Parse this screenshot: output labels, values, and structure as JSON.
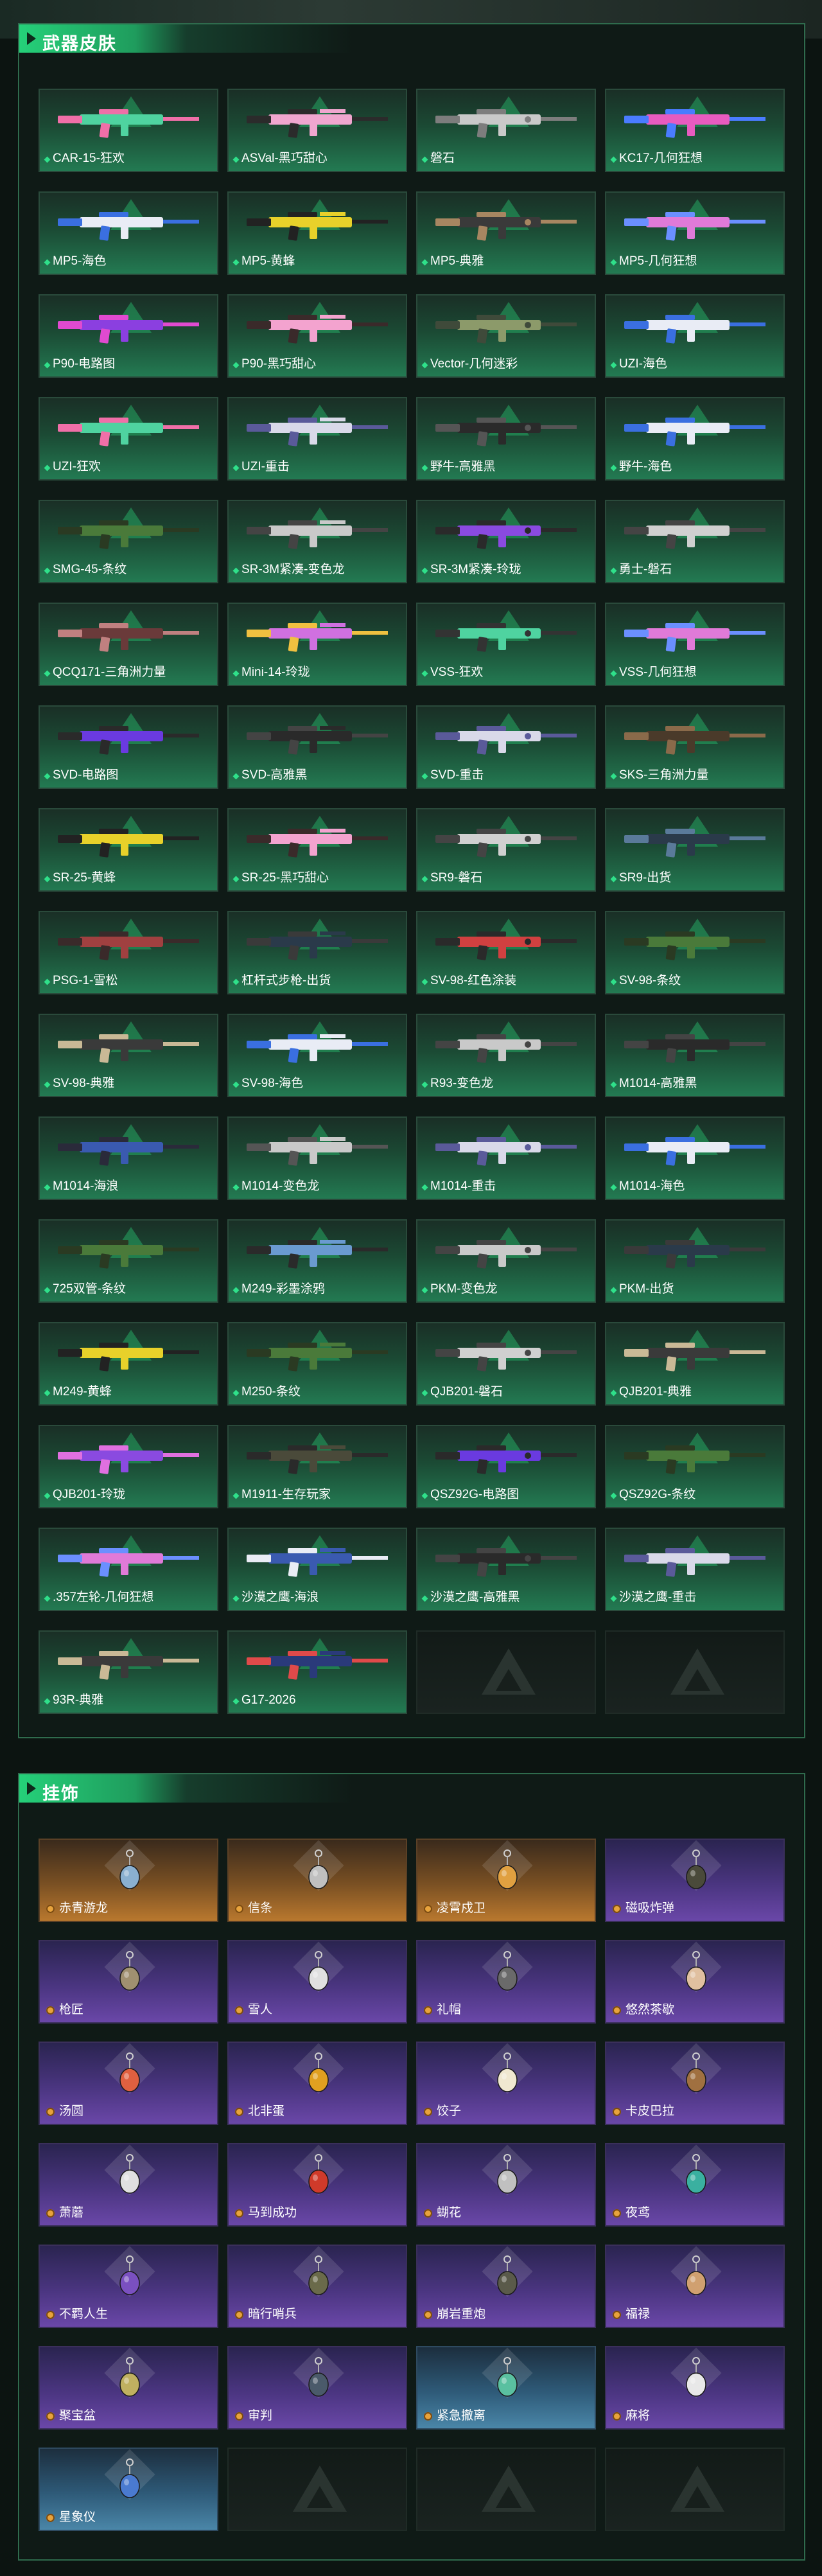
{
  "weapon_section": {
    "title": "武器皮肤",
    "items": [
      {
        "label": "CAR-15-狂欢",
        "color": "#4fd3a0",
        "accent": "#f06fa8"
      },
      {
        "label": "ASVal-黑巧甜心",
        "color": "#f0a6cf",
        "accent": "#2b2b2b"
      },
      {
        "label": "磐石",
        "color": "#c9c9c9",
        "accent": "#7d7d7d"
      },
      {
        "label": "KC17-几何狂想",
        "color": "#e85bbf",
        "accent": "#4a7cff"
      },
      {
        "label": "MP5-海色",
        "color": "#e9ecf5",
        "accent": "#3a6fe0"
      },
      {
        "label": "MP5-黄蜂",
        "color": "#e8d12a",
        "accent": "#222222"
      },
      {
        "label": "MP5-典雅",
        "color": "#3a3a3a",
        "accent": "#a78661"
      },
      {
        "label": "MP5-几何狂想",
        "color": "#e07ad8",
        "accent": "#6b8fff"
      },
      {
        "label": "P90-电路图",
        "color": "#8b3fe0",
        "accent": "#e04ad0"
      },
      {
        "label": "P90-黑巧甜心",
        "color": "#f3a3cf",
        "accent": "#3a2a2a"
      },
      {
        "label": "Vector-几何迷彩",
        "color": "#8c9a6a",
        "accent": "#3f4a3a"
      },
      {
        "label": "UZI-海色",
        "color": "#e9ecf5",
        "accent": "#3a6fe0"
      },
      {
        "label": "UZI-狂欢",
        "color": "#4fd3a0",
        "accent": "#f06fa8"
      },
      {
        "label": "UZI-重击",
        "color": "#d9d9e9",
        "accent": "#5a5a9a"
      },
      {
        "label": "野牛-高雅黑",
        "color": "#2a2a2a",
        "accent": "#555555"
      },
      {
        "label": "野牛-海色",
        "color": "#e9ecf5",
        "accent": "#3a6fe0"
      },
      {
        "label": "SMG-45-条纹",
        "color": "#4a7a3a",
        "accent": "#2a3a22"
      },
      {
        "label": "SR-3M紧凑-变色龙",
        "color": "#c9c9c9",
        "accent": "#444444"
      },
      {
        "label": "SR-3M紧凑-玲珑",
        "color": "#8a4ae0",
        "accent": "#2a2a2a"
      },
      {
        "label": "勇士-磐石",
        "color": "#d0d0d0",
        "accent": "#444444"
      },
      {
        "label": "QCQ171-三角洲力量",
        "color": "#6a3a3a",
        "accent": "#c08080"
      },
      {
        "label": "Mini-14-玲珑",
        "color": "#d070e0",
        "accent": "#f0c040"
      },
      {
        "label": "VSS-狂欢",
        "color": "#4fd3a0",
        "accent": "#333333"
      },
      {
        "label": "VSS-几何狂想",
        "color": "#e07ad8",
        "accent": "#6b8fff"
      },
      {
        "label": "SVD-电路图",
        "color": "#6a3ae0",
        "accent": "#2a2a2a"
      },
      {
        "label": "SVD-高雅黑",
        "color": "#2a2a2a",
        "accent": "#444444"
      },
      {
        "label": "SVD-重击",
        "color": "#d9d9e9",
        "accent": "#5a5a9a"
      },
      {
        "label": "SKS-三角洲力量",
        "color": "#4a3a2a",
        "accent": "#8a6a4a"
      },
      {
        "label": "SR-25-黄蜂",
        "color": "#e8d12a",
        "accent": "#222222"
      },
      {
        "label": "SR-25-黑巧甜心",
        "color": "#f3a3cf",
        "accent": "#3a2a2a"
      },
      {
        "label": "SR9-磐石",
        "color": "#d0d0d0",
        "accent": "#444444"
      },
      {
        "label": "SR9-出货",
        "color": "#2a3a4a",
        "accent": "#5a7a9a"
      },
      {
        "label": "PSG-1-雪松",
        "color": "#a04040",
        "accent": "#3a2a2a"
      },
      {
        "label": "杠杆式步枪-出货",
        "color": "#2a3a4a",
        "accent": "#3a3a3a"
      },
      {
        "label": "SV-98-红色涂装",
        "color": "#d04040",
        "accent": "#2a2a2a"
      },
      {
        "label": "SV-98-条纹",
        "color": "#4a7a3a",
        "accent": "#2a3a22"
      },
      {
        "label": "SV-98-典雅",
        "color": "#3a3a3a",
        "accent": "#c9b996"
      },
      {
        "label": "SV-98-海色",
        "color": "#e9ecf5",
        "accent": "#3a6fe0"
      },
      {
        "label": "R93-变色龙",
        "color": "#c9c9c9",
        "accent": "#444444"
      },
      {
        "label": "M1014-高雅黑",
        "color": "#2a2a2a",
        "accent": "#444444"
      },
      {
        "label": "M1014-海浪",
        "color": "#3a5ab0",
        "accent": "#2a2a3a"
      },
      {
        "label": "M1014-变色龙",
        "color": "#c9c9c9",
        "accent": "#555555"
      },
      {
        "label": "M1014-重击",
        "color": "#d9d9e9",
        "accent": "#5a5a9a"
      },
      {
        "label": "M1014-海色",
        "color": "#e9ecf5",
        "accent": "#3a6fe0"
      },
      {
        "label": "725双管-条纹",
        "color": "#4a7a3a",
        "accent": "#2a3a22"
      },
      {
        "label": "M249-彩墨涂鸦",
        "color": "#6a9ad0",
        "accent": "#2a2a2a"
      },
      {
        "label": "PKM-变色龙",
        "color": "#c9c9c9",
        "accent": "#444444"
      },
      {
        "label": "PKM-出货",
        "color": "#2a3a4a",
        "accent": "#3a3a3a"
      },
      {
        "label": "M249-黄蜂",
        "color": "#e8d12a",
        "accent": "#222222"
      },
      {
        "label": "M250-条纹",
        "color": "#4a7a3a",
        "accent": "#2a3a22"
      },
      {
        "label": "QJB201-磐石",
        "color": "#d0d0d0",
        "accent": "#444444"
      },
      {
        "label": "QJB201-典雅",
        "color": "#3a3a3a",
        "accent": "#c9b996"
      },
      {
        "label": "QJB201-玲珑",
        "color": "#8a4ae0",
        "accent": "#e070e0"
      },
      {
        "label": "M1911-生存玩家",
        "color": "#4a4a3a",
        "accent": "#2a2a2a"
      },
      {
        "label": "QSZ92G-电路图",
        "color": "#6a3ae0",
        "accent": "#2a2a2a"
      },
      {
        "label": "QSZ92G-条纹",
        "color": "#4a7a3a",
        "accent": "#2a3a22"
      },
      {
        "label": ".357左轮-几何狂想",
        "color": "#e07ad8",
        "accent": "#6b8fff"
      },
      {
        "label": "沙漠之鹰-海浪",
        "color": "#3a5ab0",
        "accent": "#e9ecf5"
      },
      {
        "label": "沙漠之鹰-高雅黑",
        "color": "#2a2a2a",
        "accent": "#444444"
      },
      {
        "label": "沙漠之鹰-重击",
        "color": "#d9d9e9",
        "accent": "#5a5a9a"
      },
      {
        "label": "93R-典雅",
        "color": "#3a3a3a",
        "accent": "#c9b996"
      },
      {
        "label": "G17-2026",
        "color": "#2a3a7a",
        "accent": "#e04a4a"
      }
    ],
    "empty_slots": 2
  },
  "charm_section": {
    "title": "挂饰",
    "items": [
      {
        "label": "赤青游龙",
        "rarity": "orange",
        "charm_color": "#8ab0d0"
      },
      {
        "label": "信条",
        "rarity": "orange",
        "charm_color": "#c0c0c0"
      },
      {
        "label": "凌霄戍卫",
        "rarity": "orange",
        "charm_color": "#e0a040"
      },
      {
        "label": "磁吸炸弹",
        "rarity": "purple",
        "charm_color": "#4a4a3a"
      },
      {
        "label": "枪匠",
        "rarity": "purple",
        "charm_color": "#a09070"
      },
      {
        "label": "雪人",
        "rarity": "purple",
        "charm_color": "#e0e0e0"
      },
      {
        "label": "礼帽",
        "rarity": "purple",
        "charm_color": "#6a6a6a"
      },
      {
        "label": "悠然茶歇",
        "rarity": "purple",
        "charm_color": "#e0c0a0"
      },
      {
        "label": "汤圆",
        "rarity": "purple",
        "charm_color": "#e06040"
      },
      {
        "label": "北非蛋",
        "rarity": "purple",
        "charm_color": "#e0a020"
      },
      {
        "label": "饺子",
        "rarity": "purple",
        "charm_color": "#f0e8d0"
      },
      {
        "label": "卡皮巴拉",
        "rarity": "purple",
        "charm_color": "#a07040"
      },
      {
        "label": "萧蘑",
        "rarity": "purple",
        "charm_color": "#e0e0e0"
      },
      {
        "label": "马到成功",
        "rarity": "purple",
        "charm_color": "#d03a2a"
      },
      {
        "label": "蝴花",
        "rarity": "purple",
        "charm_color": "#c0c0c0"
      },
      {
        "label": "夜鸢",
        "rarity": "purple",
        "charm_color": "#3ab0a0"
      },
      {
        "label": "不羁人生",
        "rarity": "purple",
        "charm_color": "#7a50c0"
      },
      {
        "label": "暗行哨兵",
        "rarity": "purple",
        "charm_color": "#6a6a4a"
      },
      {
        "label": "崩岩重炮",
        "rarity": "purple",
        "charm_color": "#5a5a4a"
      },
      {
        "label": "福禄",
        "rarity": "purple",
        "charm_color": "#d0a070"
      },
      {
        "label": "聚宝盆",
        "rarity": "purple",
        "charm_color": "#c0b060"
      },
      {
        "label": "审判",
        "rarity": "purple",
        "charm_color": "#4a5a6a"
      },
      {
        "label": "紧急撤离",
        "rarity": "blue",
        "charm_color": "#5ac0a0"
      },
      {
        "label": "麻将",
        "rarity": "purple",
        "charm_color": "#e8e8e8"
      },
      {
        "label": "星象仪",
        "rarity": "blue",
        "charm_color": "#4a7ad0"
      }
    ],
    "empty_slots": 3
  }
}
